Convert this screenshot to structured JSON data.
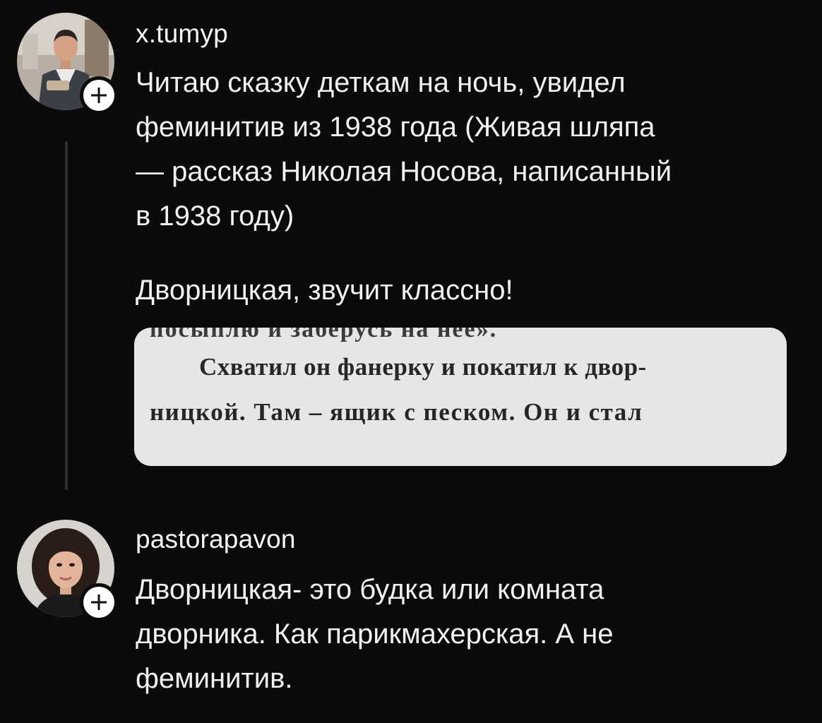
{
  "posts": [
    {
      "username": "x.tumyp",
      "text": "Читаю сказку деткам на ночь, увидел\nфеминитив из 1938 года (Живая шляпа\n— рассказ Николая Носова, написанный\nв 1938 году)",
      "text2": "Дворницкая, звучит классно!",
      "photo": {
        "lines": [
          "посыплю и заберусь на нее».",
          "Схватил он фанерку и покатил к двор-",
          "ницкой. Там – ящик с песком. Он и стал"
        ]
      }
    },
    {
      "username": "pastorapavon",
      "text": "Дворницкая- это будка или комната\nдворника. Как парикмахерская. А не\nфеминитив."
    }
  ],
  "icons": {
    "follow": "plus-icon"
  },
  "colors": {
    "background": "#0b0b0b",
    "text": "#f1f1f1",
    "thread_line": "#2f2f2f"
  }
}
